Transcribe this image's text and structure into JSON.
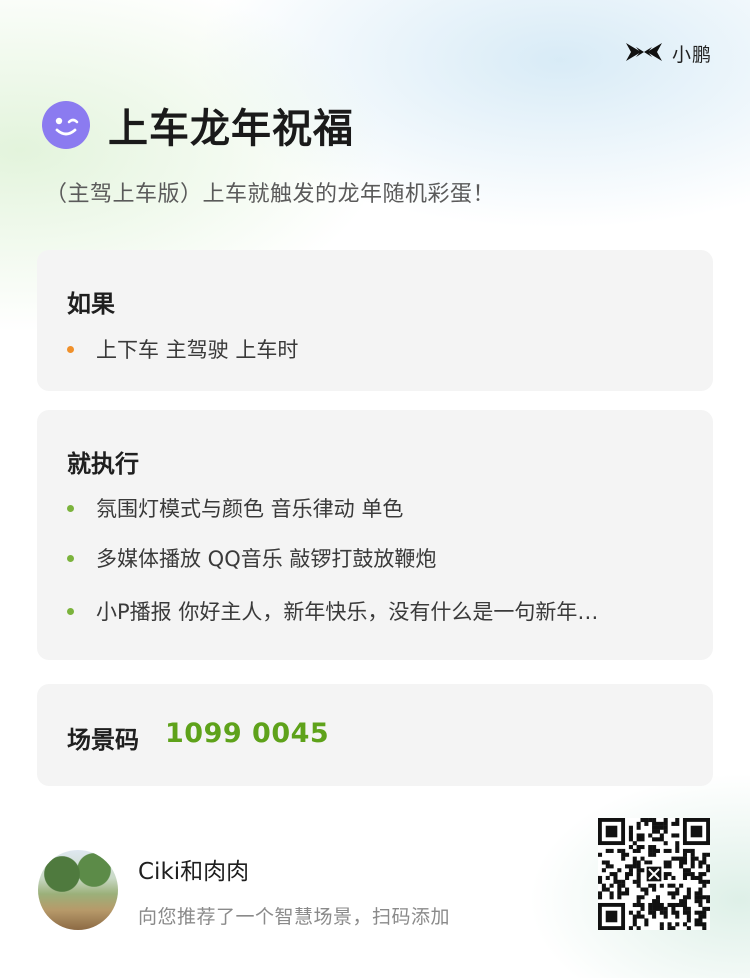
{
  "brand": {
    "name": "小鹏",
    "logo_icon": "xpeng-logo-icon"
  },
  "header": {
    "icon": "wink-face-icon",
    "title": "上车龙年祝福",
    "subtitle": "（主驾上车版）上车就触发的龙年随机彩蛋！"
  },
  "condition": {
    "heading": "如果",
    "items": [
      {
        "text": "上下车 主驾驶 上车时"
      }
    ]
  },
  "actions": {
    "heading": "就执行",
    "items": [
      {
        "text": "氛围灯模式与颜色 音乐律动 单色"
      },
      {
        "text": "多媒体播放 QQ音乐 敲锣打鼓放鞭炮"
      },
      {
        "text": "小P播报 你好主人，新年快乐，没有什么是一句新年…"
      }
    ]
  },
  "scene_code": {
    "label": "场景码",
    "value": "1099 0045"
  },
  "sharer": {
    "name": "Ciki和肉肉",
    "message": "向您推荐了一个智慧场景，扫码添加"
  },
  "colors": {
    "accent_green": "#5ea21a",
    "condition_bullet": "#f0902a",
    "action_bullet": "#7bb33c",
    "emoji_purple": "#8b7bf0"
  }
}
